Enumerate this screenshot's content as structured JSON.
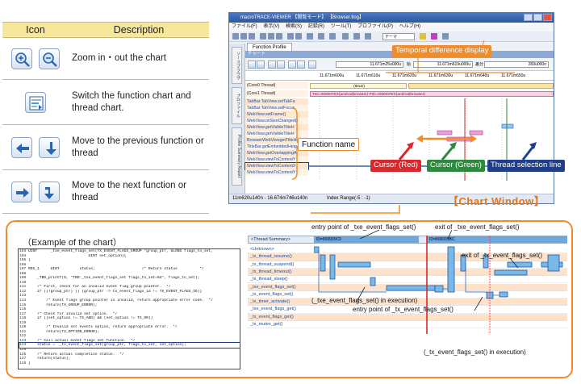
{
  "table": {
    "headers": [
      "Icon",
      "Description"
    ],
    "rows": [
      {
        "desc": "Zoom in・out the chart",
        "icons": [
          "zoom-in-icon",
          "zoom-out-icon"
        ]
      },
      {
        "desc": "Switch the function chart and thread chart.",
        "icons": [
          "switch-chart-icon"
        ]
      },
      {
        "desc": "Move to the previous function or thread",
        "icons": [
          "prev-function-icon",
          "prev-thread-icon"
        ]
      },
      {
        "desc": "Move to the next function or thread",
        "icons": [
          "next-function-icon",
          "next-thread-icon"
        ]
      }
    ]
  },
  "app": {
    "title": "macroTRACE-VIEWER 【閲覧モード】 【Browser.tlog】",
    "menu": [
      "ファイル(F)",
      "表示(V)",
      "検索(S)",
      "記録(R)",
      "ツール(T)",
      "プロファイル(P)",
      "ヘルプ(H)"
    ],
    "toolbar_input": "テーマ",
    "tab": "Function Profile",
    "chart_header": "チャート",
    "side_tabs": [
      "ソースブラウザ",
      "プロファイル",
      "Profile Summary Report"
    ],
    "fields": [
      "11.671m25u000u",
      "11.671m619u000u",
      "269u000n"
    ],
    "field_labels": [
      "始",
      "差分"
    ],
    "ruler": [
      "11.671m600u",
      "11.671m610u",
      "11.671m620u",
      "11.671m630u",
      "11.671m640u",
      "11.671m650u"
    ],
    "thread_rows": [
      "(Core0 Thread)",
      "(Core1 Thread)"
    ],
    "function_rows": [
      "TabBar.TabView.setTabFa",
      "TabBar.TabView.setFocus",
      "WebView.setFrame()",
      "WebView.onSizeChanged()",
      "WebView.getVisibleTitleH",
      "WebView.getVisibleTitleH",
      "BrowserWebViewgetTitleH",
      "TitleBar.getEmbeddedHeig",
      "WebView.getOverlappingA",
      "WebView.viewToContentY",
      "WebView.viewToContentX",
      "WebView.viewToContentY"
    ],
    "idle_label": "(IDLE)",
    "core1_band": "TID=000007EX(androidbrowser) PID=000007EX(androidbrowser)",
    "status": "11m620u140n - 16.674m746u140n",
    "index_range": "Index Range(-5 : -1)"
  },
  "callouts": {
    "function_name": "Function name",
    "temporal": "Temporal difference display",
    "cursor_red": "Cursor (Red)",
    "cursor_green": "Cursor (Green)",
    "thread_line": "Thread selection line",
    "chart_window": "【Chart Window】"
  },
  "example": {
    "title": "（Example of the chart）",
    "code": [
      {
        "n": "103",
        "t": "UINT      _txe_event_flags_set(TX_EVENT_FLAGS_GROUP *group_ptr, ULONG flags_to_set, "
      },
      {
        "n": "104",
        "t": "                           UINT set_option){"
      },
      {
        "n": "105",
        "t": "{"
      },
      {
        "n": "106",
        "t": ""
      },
      {
        "n": "107",
        "t": "REG_1     UINT         status;                     /* Return status          */"
      },
      {
        "n": "108",
        "t": ""
      },
      {
        "n": "109",
        "t": "    _TBD_printf(0, \"TBD:_txe_event_flags_set flags_to_set=%d\", flags_to_set);"
      },
      {
        "n": "110",
        "t": ""
      },
      {
        "n": "111",
        "t": "    /* First, check for an invalid event flag group pointer.  */"
      },
      {
        "n": "112",
        "t": "    if ((!group_ptr) || (group_ptr -> tx_event_flags_id != TX_EVENT_FLAGS_ID))"
      },
      {
        "n": "113",
        "t": ""
      },
      {
        "n": "114",
        "t": "        /* Event flags group pointer is invalid, return appropriate error code.  */"
      },
      {
        "n": "115",
        "t": "        return(TX_GROUP_ERROR);"
      },
      {
        "n": "116",
        "t": ""
      },
      {
        "n": "117",
        "t": "    /* Check for invalid set option.  */"
      },
      {
        "n": "118",
        "t": "    if ((set_option != TX_AND) && (set_option != TX_OR))"
      },
      {
        "n": "119",
        "t": ""
      },
      {
        "n": "120",
        "t": "        /* Invalid set events option, return appropriate error.  */"
      },
      {
        "n": "121",
        "t": "        return(TX_OPTION_ERROR);"
      },
      {
        "n": "122",
        "t": ""
      },
      {
        "n": "123",
        "t": "    /* Call actual event flags set function.  */"
      },
      {
        "n": "124",
        "t": "    status =  _tx_event_flags_set(group_ptr, flags_to_set, set_option);"
      },
      {
        "n": "125",
        "t": ""
      },
      {
        "n": "126",
        "t": "    /* Return actual completion status.  */"
      },
      {
        "n": "127",
        "t": "    return(status);"
      },
      {
        "n": "128",
        "t": "}"
      }
    ],
    "summary_label": "<Thread Summary>",
    "id_bands": [
      "ID=800009C0",
      "ID=800009BC"
    ],
    "rows": [
      "<Unknown>",
      "_tx_thread_resume()",
      "_tx_thread_suspend()",
      "_tx_thread_timeout()",
      "_tx_thread_sleep()",
      "_txe_event_flags_set()",
      "_tx_event_flags_set()",
      "_tx_timer_activate()",
      "_txe_event_flags_get()",
      "_tx_event_flags_get()",
      "_tx_mutex_get()"
    ],
    "ann_entry_txe": "entry point of _txe_event_flags_set()",
    "ann_exit_txe": "exit of _txe_event_flags_set()",
    "ann_exit_tx": "exit of _tx_event_flags_set()",
    "ann_in_exec": "(_txe_event_flags_set() in execution)",
    "ann_entry_tx": "entry point of _tx_event_flags_set()",
    "ann_tx_in_exec": "(_tx_event_flags_set() in execution)"
  },
  "colors": {
    "accent": "#f08c2a",
    "cursor_red": "#d9282c",
    "cursor_green": "#2d8a3e",
    "thread_line": "#1f3f8a",
    "header_yellow": "#f7e79a"
  }
}
